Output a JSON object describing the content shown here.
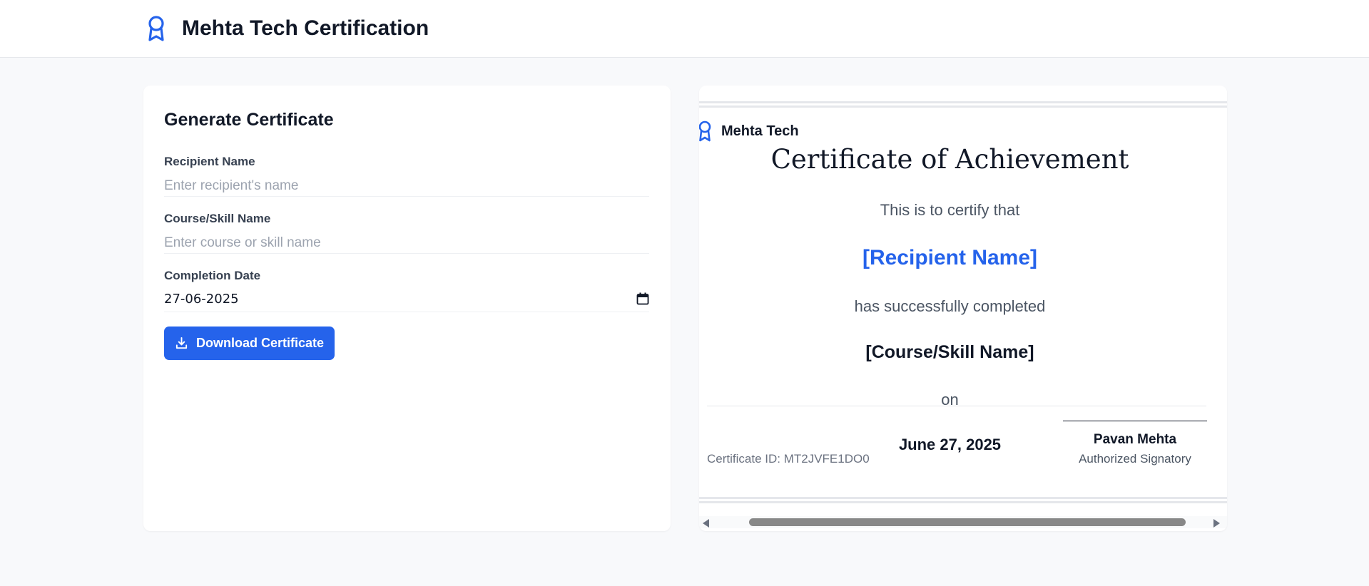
{
  "header": {
    "title": "Mehta Tech Certification",
    "icon": "award-ribbon-icon",
    "accent_color": "#2563eb"
  },
  "form": {
    "title": "Generate Certificate",
    "recipient_label": "Recipient Name",
    "recipient_placeholder": "Enter recipient's name",
    "recipient_value": "",
    "course_label": "Course/Skill Name",
    "course_placeholder": "Enter course or skill name",
    "course_value": "",
    "date_label": "Completion Date",
    "date_value": "27-06-2025",
    "download_label": "Download Certificate"
  },
  "certificate": {
    "brand": "Mehta Tech",
    "heading": "Certificate of Achievement",
    "intro": "This is to certify that",
    "recipient": "[Recipient Name]",
    "completed": "has successfully completed",
    "course": "[Course/Skill Name]",
    "on": "on",
    "date": "June 27, 2025",
    "certificate_id": "Certificate ID: MT2JVFE1DO0",
    "signatory_name": "Pavan Mehta",
    "signatory_title": "Authorized Signatory"
  }
}
